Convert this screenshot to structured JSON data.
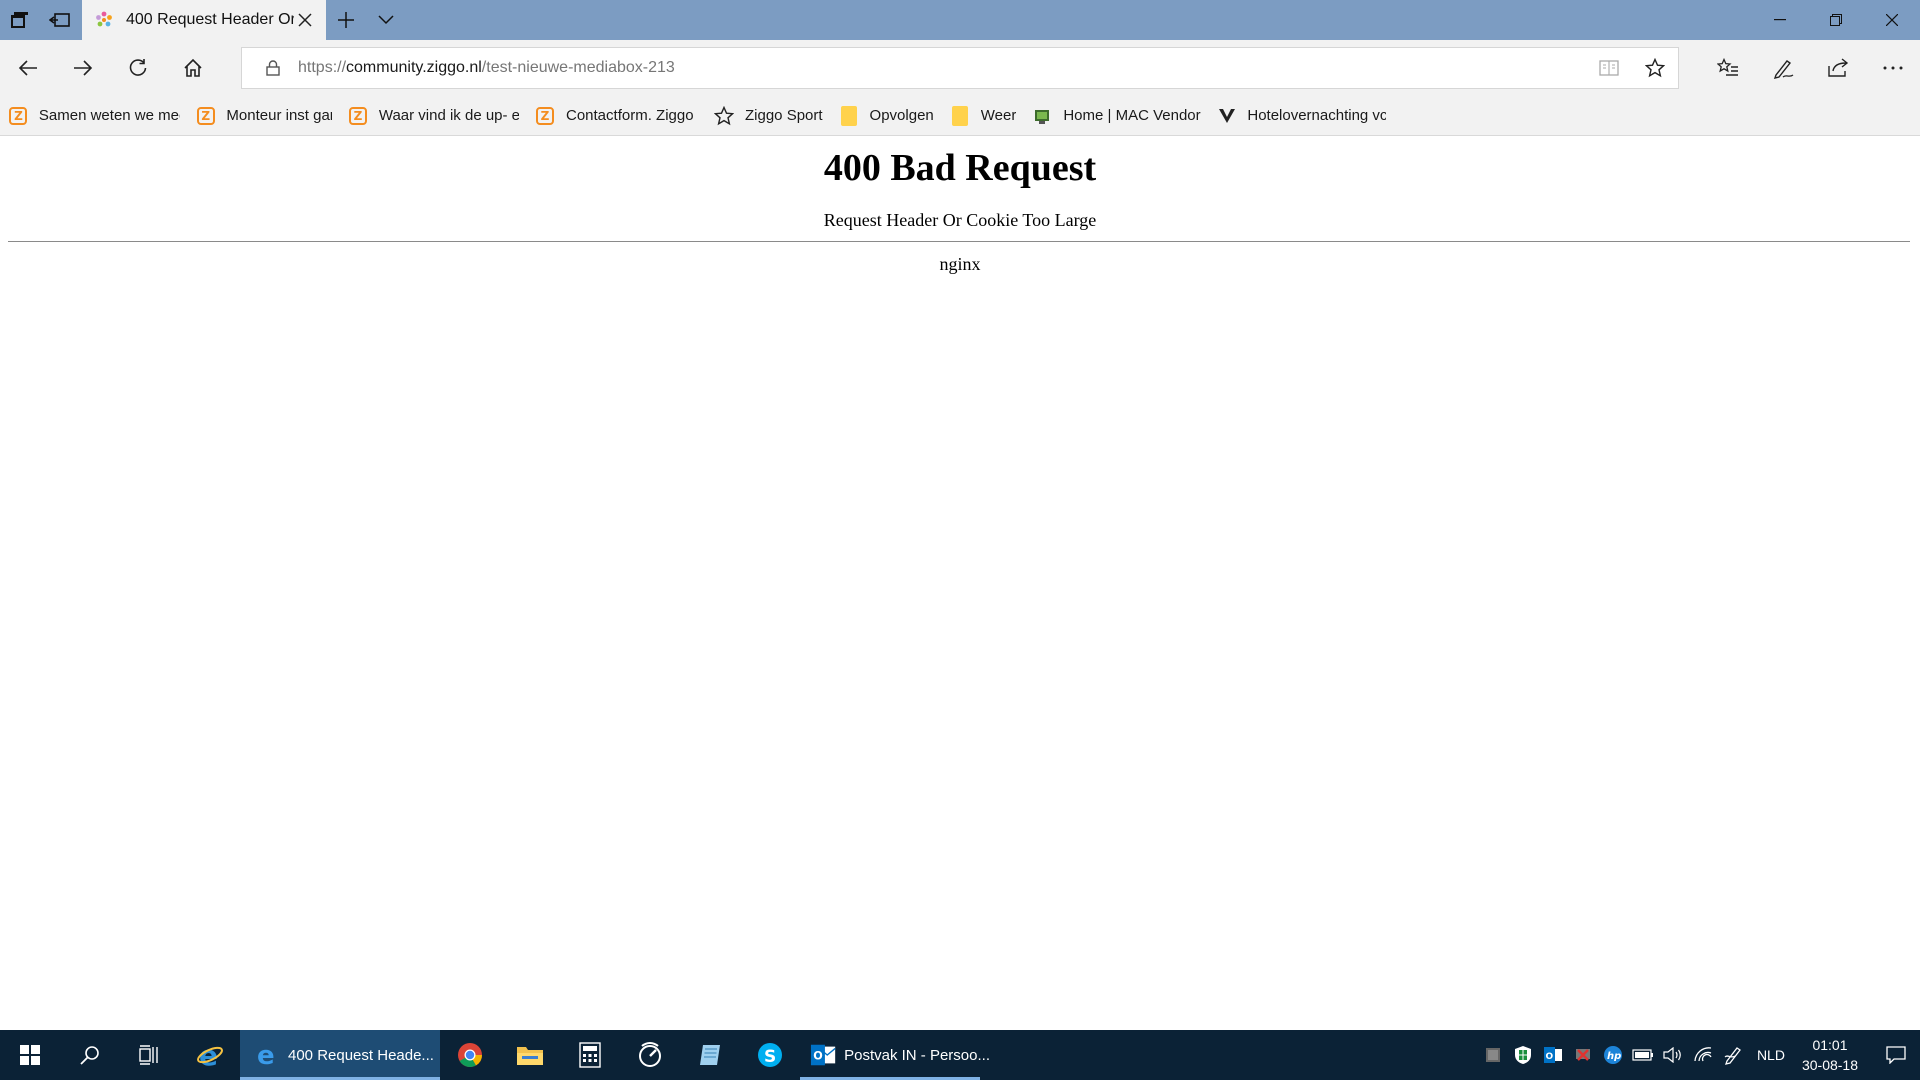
{
  "browser": {
    "tab": {
      "title": "400 Request Header Or"
    },
    "address": {
      "scheme": "https://",
      "host": "community.ziggo.nl",
      "path": "/test-nieuwe-mediabox-213"
    }
  },
  "favorites": [
    {
      "label": "Samen weten we mee",
      "icon": "ziggo-icon"
    },
    {
      "label": "Monteur inst gar",
      "icon": "ziggo-icon"
    },
    {
      "label": "Waar vind ik de up- e",
      "icon": "ziggo-icon"
    },
    {
      "label": "Contactform. Ziggo",
      "icon": "ziggo-icon"
    },
    {
      "label": "Ziggo Sport",
      "icon": "star-outline-icon"
    },
    {
      "label": "Opvolgen",
      "icon": "folder-icon"
    },
    {
      "label": "Weer",
      "icon": "folder-icon"
    },
    {
      "label": "Home | MAC Vendor",
      "icon": "mac-vendor-icon"
    },
    {
      "label": "Hotelovernachting vc",
      "icon": "v-logo-icon"
    }
  ],
  "page": {
    "heading": "400 Bad Request",
    "message": "Request Header Or Cookie Too Large",
    "server": "nginx"
  },
  "taskbar": {
    "edge_window": "400 Request Heade...",
    "outlook_window": "Postvak IN - Persoo...",
    "language": "NLD",
    "time": "01:01",
    "date": "30-08-18"
  },
  "colors": {
    "titlebar": "#7c9cc2",
    "toolbar": "#f2f2f2",
    "taskbar": "#0b2236",
    "taskbar_active": "#1e4c74",
    "ziggo_orange": "#f48d1f"
  }
}
